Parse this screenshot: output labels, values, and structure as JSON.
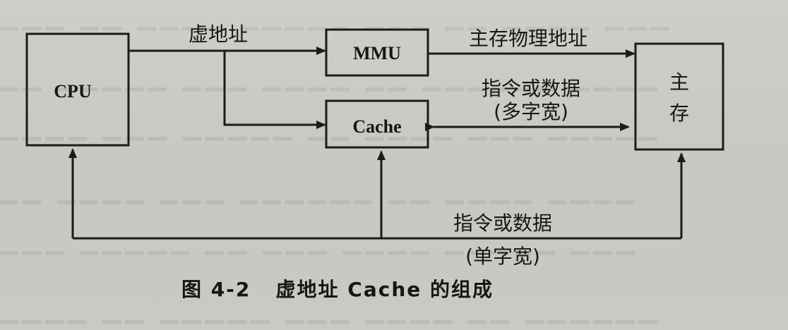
{
  "diagram": {
    "boxes": {
      "cpu": "CPU",
      "mmu": "MMU",
      "cache": "Cache",
      "main_memory_line1": "主",
      "main_memory_line2": "存"
    },
    "labels": {
      "virtual_address": "虚地址",
      "physical_address": "主存物理地址",
      "multi_word_line1": "指令或数据",
      "multi_word_line2": "(多字宽)",
      "single_word_line1": "指令或数据",
      "single_word_line2": "(单字宽)"
    },
    "caption": "图 4-2   虚地址 Cache 的组成"
  },
  "colors": {
    "ink": "#1b1b1b",
    "paper": "#cbc9c3"
  }
}
